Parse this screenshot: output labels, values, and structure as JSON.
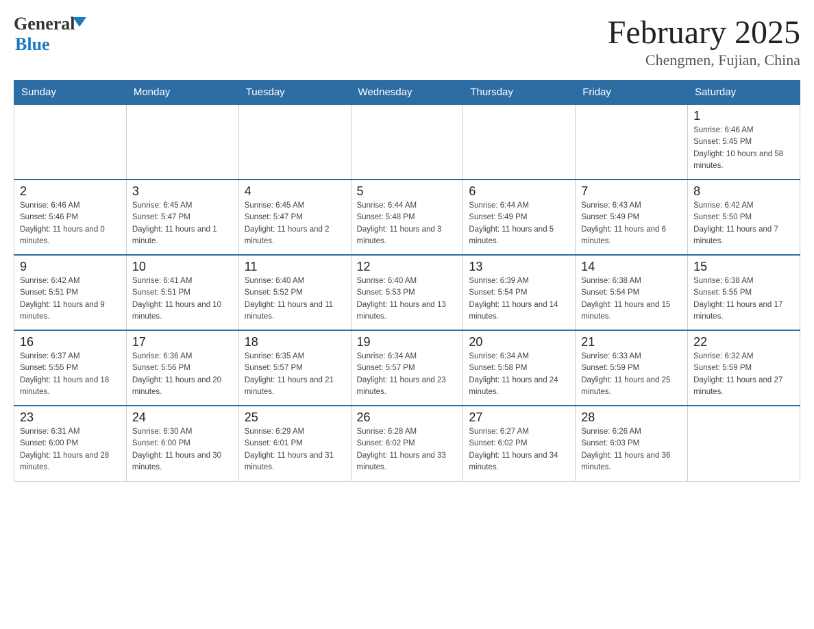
{
  "header": {
    "logo_general": "General",
    "logo_blue": "Blue",
    "month_title": "February 2025",
    "location": "Chengmen, Fujian, China"
  },
  "days_of_week": [
    "Sunday",
    "Monday",
    "Tuesday",
    "Wednesday",
    "Thursday",
    "Friday",
    "Saturday"
  ],
  "weeks": [
    {
      "days": [
        {
          "number": "",
          "sunrise": "",
          "sunset": "",
          "daylight": "",
          "empty": true
        },
        {
          "number": "",
          "sunrise": "",
          "sunset": "",
          "daylight": "",
          "empty": true
        },
        {
          "number": "",
          "sunrise": "",
          "sunset": "",
          "daylight": "",
          "empty": true
        },
        {
          "number": "",
          "sunrise": "",
          "sunset": "",
          "daylight": "",
          "empty": true
        },
        {
          "number": "",
          "sunrise": "",
          "sunset": "",
          "daylight": "",
          "empty": true
        },
        {
          "number": "",
          "sunrise": "",
          "sunset": "",
          "daylight": "",
          "empty": true
        },
        {
          "number": "1",
          "sunrise": "Sunrise: 6:46 AM",
          "sunset": "Sunset: 5:45 PM",
          "daylight": "Daylight: 10 hours and 58 minutes.",
          "empty": false
        }
      ]
    },
    {
      "days": [
        {
          "number": "2",
          "sunrise": "Sunrise: 6:46 AM",
          "sunset": "Sunset: 5:46 PM",
          "daylight": "Daylight: 11 hours and 0 minutes.",
          "empty": false
        },
        {
          "number": "3",
          "sunrise": "Sunrise: 6:45 AM",
          "sunset": "Sunset: 5:47 PM",
          "daylight": "Daylight: 11 hours and 1 minute.",
          "empty": false
        },
        {
          "number": "4",
          "sunrise": "Sunrise: 6:45 AM",
          "sunset": "Sunset: 5:47 PM",
          "daylight": "Daylight: 11 hours and 2 minutes.",
          "empty": false
        },
        {
          "number": "5",
          "sunrise": "Sunrise: 6:44 AM",
          "sunset": "Sunset: 5:48 PM",
          "daylight": "Daylight: 11 hours and 3 minutes.",
          "empty": false
        },
        {
          "number": "6",
          "sunrise": "Sunrise: 6:44 AM",
          "sunset": "Sunset: 5:49 PM",
          "daylight": "Daylight: 11 hours and 5 minutes.",
          "empty": false
        },
        {
          "number": "7",
          "sunrise": "Sunrise: 6:43 AM",
          "sunset": "Sunset: 5:49 PM",
          "daylight": "Daylight: 11 hours and 6 minutes.",
          "empty": false
        },
        {
          "number": "8",
          "sunrise": "Sunrise: 6:42 AM",
          "sunset": "Sunset: 5:50 PM",
          "daylight": "Daylight: 11 hours and 7 minutes.",
          "empty": false
        }
      ]
    },
    {
      "days": [
        {
          "number": "9",
          "sunrise": "Sunrise: 6:42 AM",
          "sunset": "Sunset: 5:51 PM",
          "daylight": "Daylight: 11 hours and 9 minutes.",
          "empty": false
        },
        {
          "number": "10",
          "sunrise": "Sunrise: 6:41 AM",
          "sunset": "Sunset: 5:51 PM",
          "daylight": "Daylight: 11 hours and 10 minutes.",
          "empty": false
        },
        {
          "number": "11",
          "sunrise": "Sunrise: 6:40 AM",
          "sunset": "Sunset: 5:52 PM",
          "daylight": "Daylight: 11 hours and 11 minutes.",
          "empty": false
        },
        {
          "number": "12",
          "sunrise": "Sunrise: 6:40 AM",
          "sunset": "Sunset: 5:53 PM",
          "daylight": "Daylight: 11 hours and 13 minutes.",
          "empty": false
        },
        {
          "number": "13",
          "sunrise": "Sunrise: 6:39 AM",
          "sunset": "Sunset: 5:54 PM",
          "daylight": "Daylight: 11 hours and 14 minutes.",
          "empty": false
        },
        {
          "number": "14",
          "sunrise": "Sunrise: 6:38 AM",
          "sunset": "Sunset: 5:54 PM",
          "daylight": "Daylight: 11 hours and 15 minutes.",
          "empty": false
        },
        {
          "number": "15",
          "sunrise": "Sunrise: 6:38 AM",
          "sunset": "Sunset: 5:55 PM",
          "daylight": "Daylight: 11 hours and 17 minutes.",
          "empty": false
        }
      ]
    },
    {
      "days": [
        {
          "number": "16",
          "sunrise": "Sunrise: 6:37 AM",
          "sunset": "Sunset: 5:55 PM",
          "daylight": "Daylight: 11 hours and 18 minutes.",
          "empty": false
        },
        {
          "number": "17",
          "sunrise": "Sunrise: 6:36 AM",
          "sunset": "Sunset: 5:56 PM",
          "daylight": "Daylight: 11 hours and 20 minutes.",
          "empty": false
        },
        {
          "number": "18",
          "sunrise": "Sunrise: 6:35 AM",
          "sunset": "Sunset: 5:57 PM",
          "daylight": "Daylight: 11 hours and 21 minutes.",
          "empty": false
        },
        {
          "number": "19",
          "sunrise": "Sunrise: 6:34 AM",
          "sunset": "Sunset: 5:57 PM",
          "daylight": "Daylight: 11 hours and 23 minutes.",
          "empty": false
        },
        {
          "number": "20",
          "sunrise": "Sunrise: 6:34 AM",
          "sunset": "Sunset: 5:58 PM",
          "daylight": "Daylight: 11 hours and 24 minutes.",
          "empty": false
        },
        {
          "number": "21",
          "sunrise": "Sunrise: 6:33 AM",
          "sunset": "Sunset: 5:59 PM",
          "daylight": "Daylight: 11 hours and 25 minutes.",
          "empty": false
        },
        {
          "number": "22",
          "sunrise": "Sunrise: 6:32 AM",
          "sunset": "Sunset: 5:59 PM",
          "daylight": "Daylight: 11 hours and 27 minutes.",
          "empty": false
        }
      ]
    },
    {
      "days": [
        {
          "number": "23",
          "sunrise": "Sunrise: 6:31 AM",
          "sunset": "Sunset: 6:00 PM",
          "daylight": "Daylight: 11 hours and 28 minutes.",
          "empty": false
        },
        {
          "number": "24",
          "sunrise": "Sunrise: 6:30 AM",
          "sunset": "Sunset: 6:00 PM",
          "daylight": "Daylight: 11 hours and 30 minutes.",
          "empty": false
        },
        {
          "number": "25",
          "sunrise": "Sunrise: 6:29 AM",
          "sunset": "Sunset: 6:01 PM",
          "daylight": "Daylight: 11 hours and 31 minutes.",
          "empty": false
        },
        {
          "number": "26",
          "sunrise": "Sunrise: 6:28 AM",
          "sunset": "Sunset: 6:02 PM",
          "daylight": "Daylight: 11 hours and 33 minutes.",
          "empty": false
        },
        {
          "number": "27",
          "sunrise": "Sunrise: 6:27 AM",
          "sunset": "Sunset: 6:02 PM",
          "daylight": "Daylight: 11 hours and 34 minutes.",
          "empty": false
        },
        {
          "number": "28",
          "sunrise": "Sunrise: 6:26 AM",
          "sunset": "Sunset: 6:03 PM",
          "daylight": "Daylight: 11 hours and 36 minutes.",
          "empty": false
        },
        {
          "number": "",
          "sunrise": "",
          "sunset": "",
          "daylight": "",
          "empty": true
        }
      ]
    }
  ]
}
